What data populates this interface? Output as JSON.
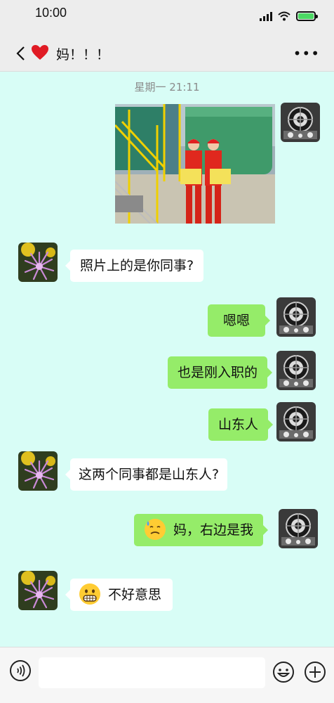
{
  "status_bar": {
    "time": "10:00",
    "icons": [
      "signal-icon",
      "wifi-icon",
      "battery-charging-icon"
    ]
  },
  "header": {
    "back_icon": "chevron-left-icon",
    "heart_icon": "heart-emoji-icon",
    "title": "妈！！！",
    "more_icon": "more-dots-icon",
    "more_text": "•••"
  },
  "chat": {
    "timestamp": "星期一 21:11",
    "messages": [
      {
        "side": "right",
        "type": "image",
        "content": "photo of two workers in red uniforms holding signs",
        "avatar": "self-avatar"
      },
      {
        "side": "left",
        "type": "text",
        "text": "照片上的是你同事?",
        "avatar": "mom-avatar"
      },
      {
        "side": "right",
        "type": "text",
        "text": "嗯嗯",
        "avatar": "self-avatar"
      },
      {
        "side": "right",
        "type": "text",
        "text": "也是刚入职的",
        "avatar": "self-avatar"
      },
      {
        "side": "right",
        "type": "text",
        "text": "山东人",
        "avatar": "self-avatar"
      },
      {
        "side": "left",
        "type": "text",
        "text": "这两个同事都是山东人?",
        "avatar": "mom-avatar"
      },
      {
        "side": "right",
        "type": "text",
        "text": "妈，右边是我",
        "emoji": "sweat-smile-emoji",
        "avatar": "self-avatar"
      },
      {
        "side": "left",
        "type": "text",
        "text": "不好意思",
        "emoji": "grimacing-emoji",
        "avatar": "mom-avatar"
      }
    ]
  },
  "input_bar": {
    "voice_icon": "voice-icon",
    "placeholder": "",
    "emoji_icon": "emoji-icon",
    "plus_icon": "plus-icon"
  },
  "colors": {
    "chat_background": "#d8fdf6",
    "sent_bubble": "#95ec69",
    "received_bubble": "#ffffff",
    "header_background": "#ededed"
  }
}
